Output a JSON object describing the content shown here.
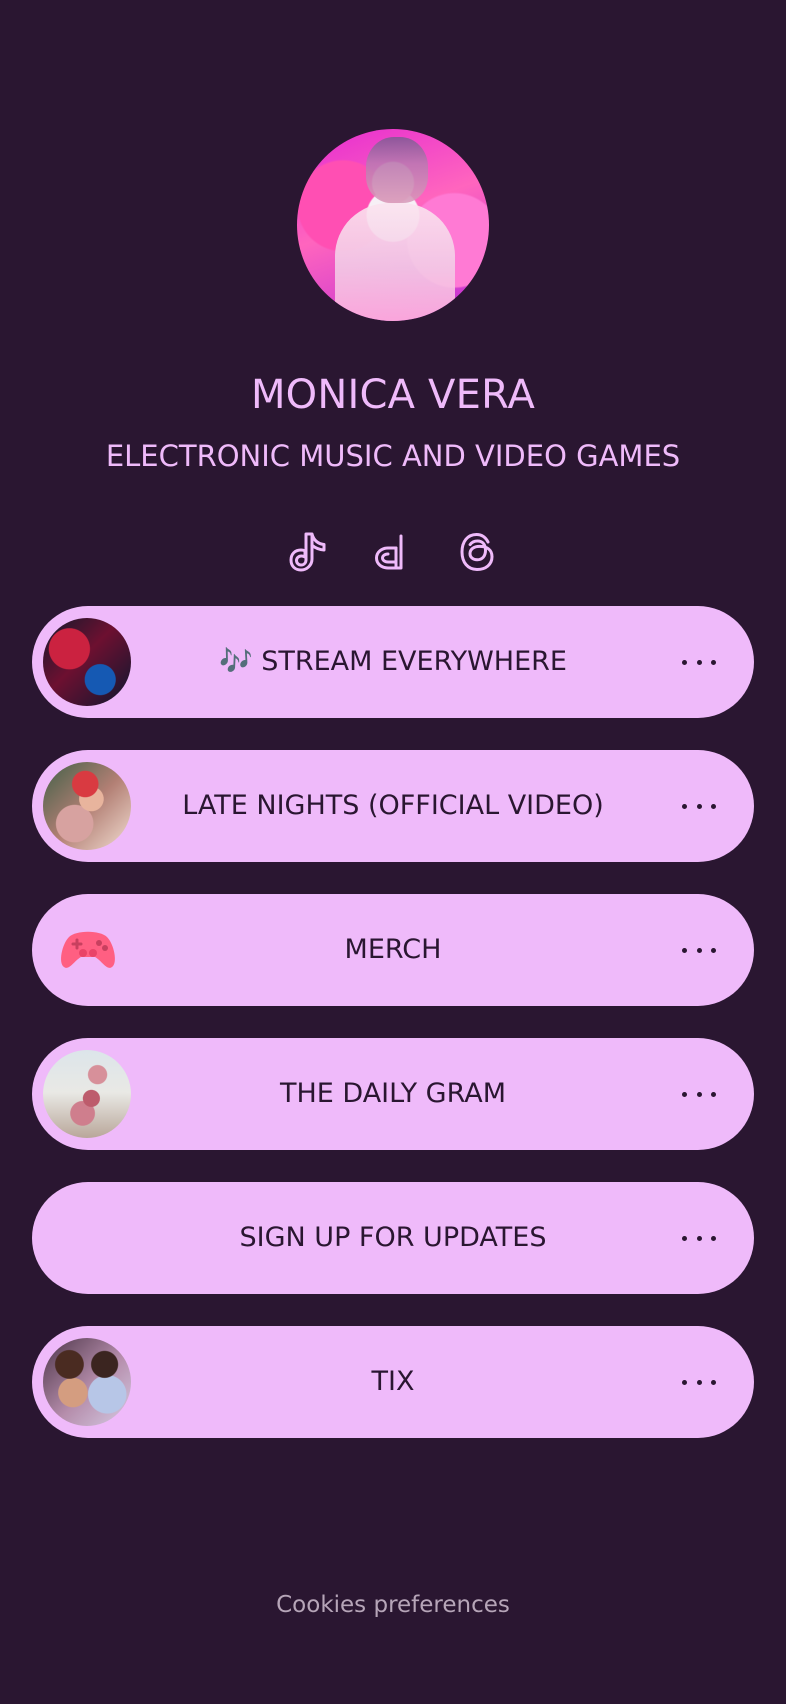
{
  "profile": {
    "name": "MONICA VERA",
    "subtitle": "ELECTRONIC MUSIC AND VIDEO GAMES",
    "avatar_icon": "profile-avatar"
  },
  "socials": [
    {
      "name": "tiktok",
      "icon": "tiktok-icon"
    },
    {
      "name": "deezer",
      "icon": "deezer-icon"
    },
    {
      "name": "threads",
      "icon": "threads-icon"
    }
  ],
  "links": [
    {
      "label": "🎶 STREAM EVERYWHERE",
      "thumb": "stream-thumbnail"
    },
    {
      "label": "LATE NIGHTS (OFFICIAL VIDEO)",
      "thumb": "late-nights-thumbnail"
    },
    {
      "label": "MERCH",
      "thumb": "game-controller-icon"
    },
    {
      "label": "THE DAILY GRAM",
      "thumb": "daily-gram-thumbnail"
    },
    {
      "label": "SIGN UP FOR UPDATES",
      "thumb": ""
    },
    {
      "label": "TIX",
      "thumb": "tix-thumbnail"
    }
  ],
  "footer": {
    "cookies": "Cookies preferences"
  },
  "colors": {
    "background": "#2a1631",
    "accent": "#efbafa",
    "button_text": "#2a1631",
    "footer_text": "#b6a5b8"
  }
}
